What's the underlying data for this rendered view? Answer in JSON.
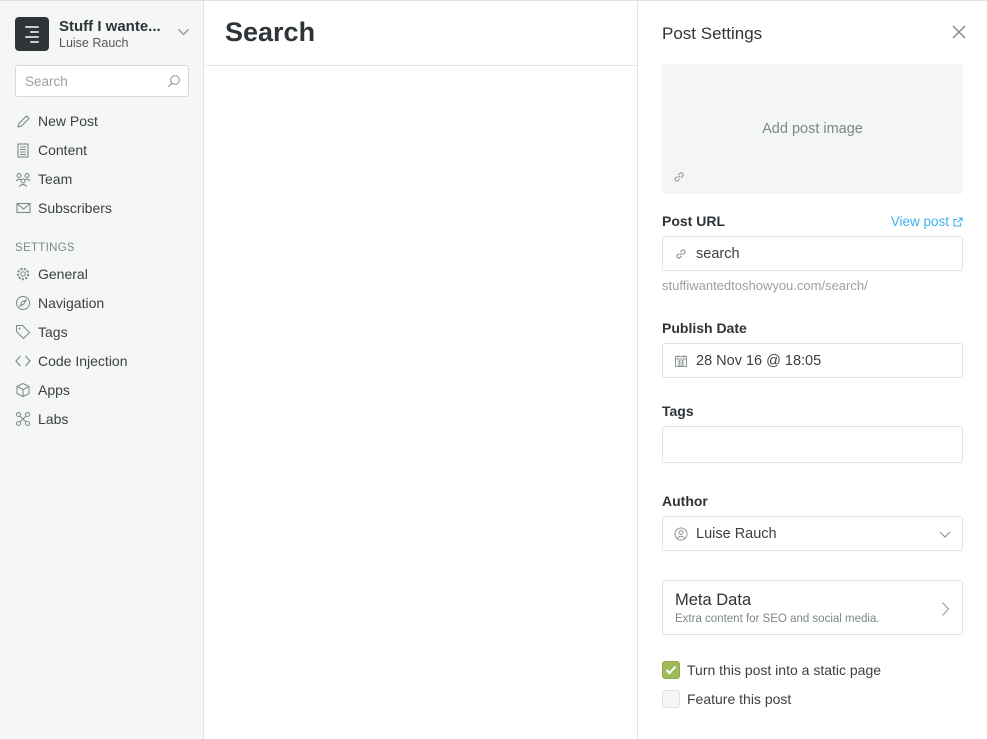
{
  "sidebar": {
    "blog_title": "Stuff I wante...",
    "user_name": "Luise Rauch",
    "search_placeholder": "Search",
    "nav": [
      {
        "label": "New Post",
        "icon": "pencil-icon"
      },
      {
        "label": "Content",
        "icon": "document-icon"
      },
      {
        "label": "Team",
        "icon": "team-icon"
      },
      {
        "label": "Subscribers",
        "icon": "envelope-icon"
      }
    ],
    "settings_label": "SETTINGS",
    "settings": [
      {
        "label": "General",
        "icon": "gear-icon"
      },
      {
        "label": "Navigation",
        "icon": "compass-icon"
      },
      {
        "label": "Tags",
        "icon": "tag-icon"
      },
      {
        "label": "Code Injection",
        "icon": "code-icon"
      },
      {
        "label": "Apps",
        "icon": "box-icon"
      },
      {
        "label": "Labs",
        "icon": "labs-icon"
      }
    ]
  },
  "main": {
    "title": "Search"
  },
  "panel": {
    "title": "Post Settings",
    "add_image_label": "Add post image",
    "post_url_label": "Post URL",
    "view_post_label": "View post",
    "post_url_value": "search",
    "post_url_hint": "stuffiwantedtoshowyou.com/search/",
    "publish_date_label": "Publish Date",
    "publish_date_value": "28 Nov 16 @ 18:05",
    "tags_label": "Tags",
    "tags_value": "",
    "author_label": "Author",
    "author_value": "Luise Rauch",
    "meta_title": "Meta Data",
    "meta_subtitle": "Extra content for SEO and social media.",
    "static_page_label": "Turn this post into a static page",
    "static_page_checked": true,
    "feature_label": "Feature this post",
    "feature_checked": false
  },
  "colors": {
    "accent_link": "#3eb0ef",
    "checkbox_green": "#9fbb58",
    "sidebar_bg": "#f5f6f6"
  }
}
